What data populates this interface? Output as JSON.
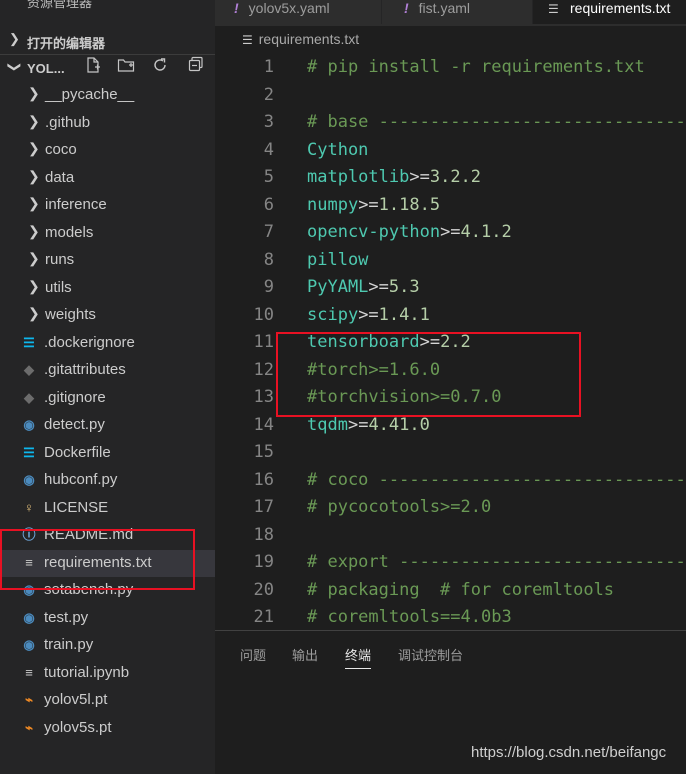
{
  "sidebar": {
    "title": "资源管理器",
    "more": "···",
    "open_editors_label": "打开的编辑器",
    "project_label": "YOL...",
    "actions": [
      "new-file-icon",
      "new-folder-icon",
      "refresh-icon",
      "collapse-all-icon"
    ],
    "items": [
      {
        "label": "__pycache__",
        "type": "folder"
      },
      {
        "label": ".github",
        "type": "folder"
      },
      {
        "label": "coco",
        "type": "folder"
      },
      {
        "label": "data",
        "type": "folder"
      },
      {
        "label": "inference",
        "type": "folder"
      },
      {
        "label": "models",
        "type": "folder"
      },
      {
        "label": "runs",
        "type": "folder"
      },
      {
        "label": "utils",
        "type": "folder"
      },
      {
        "label": "weights",
        "type": "folder"
      },
      {
        "label": ".dockerignore",
        "type": "docker"
      },
      {
        "label": ".gitattributes",
        "type": "git"
      },
      {
        "label": ".gitignore",
        "type": "git"
      },
      {
        "label": "detect.py",
        "type": "python"
      },
      {
        "label": "Dockerfile",
        "type": "docker"
      },
      {
        "label": "hubconf.py",
        "type": "python"
      },
      {
        "label": "LICENSE",
        "type": "license"
      },
      {
        "label": "README.md",
        "type": "info"
      },
      {
        "label": "requirements.txt",
        "type": "text"
      },
      {
        "label": "sotabench.py",
        "type": "python"
      },
      {
        "label": "test.py",
        "type": "python"
      },
      {
        "label": "train.py",
        "type": "python"
      },
      {
        "label": "tutorial.ipynb",
        "type": "text"
      },
      {
        "label": "yolov5l.pt",
        "type": "rss"
      },
      {
        "label": "yolov5s.pt",
        "type": "rss"
      }
    ]
  },
  "tabs": [
    {
      "label": "yolov5x.yaml",
      "active": false
    },
    {
      "label": "fist.yaml",
      "active": false
    },
    {
      "label": "requirements.txt",
      "active": true
    }
  ],
  "breadcrumb": "requirements.txt",
  "code_lines": [
    {
      "n": "1",
      "text": "# pip install -r requirements.txt"
    },
    {
      "n": "2",
      "text": ""
    },
    {
      "n": "3",
      "text": "# base ----------------------------------------"
    },
    {
      "n": "4",
      "text": "Cython"
    },
    {
      "n": "5",
      "text": "matplotlib>=3.2.2"
    },
    {
      "n": "6",
      "text": "numpy>=1.18.5"
    },
    {
      "n": "7",
      "text": "opencv-python>=4.1.2"
    },
    {
      "n": "8",
      "text": "pillow"
    },
    {
      "n": "9",
      "text": "PyYAML>=5.3"
    },
    {
      "n": "10",
      "text": "scipy>=1.4.1"
    },
    {
      "n": "11",
      "text": "tensorboard>=2.2"
    },
    {
      "n": "12",
      "text": "#torch>=1.6.0"
    },
    {
      "n": "13",
      "text": "#torchvision>=0.7.0"
    },
    {
      "n": "14",
      "text": "tqdm>=4.41.0"
    },
    {
      "n": "15",
      "text": ""
    },
    {
      "n": "16",
      "text": "# coco ----------------------------------------"
    },
    {
      "n": "17",
      "text": "# pycocotools>=2.0"
    },
    {
      "n": "18",
      "text": ""
    },
    {
      "n": "19",
      "text": "# export --------------------------------------"
    },
    {
      "n": "20",
      "text": "# packaging  # for coremltools"
    },
    {
      "n": "21",
      "text": "# coremltools==4.0b3"
    }
  ],
  "panel_tabs": [
    {
      "label": "问题",
      "active": false
    },
    {
      "label": "输出",
      "active": false
    },
    {
      "label": "终端",
      "active": true
    },
    {
      "label": "调试控制台",
      "active": false
    }
  ],
  "watermark": "https://blog.csdn.net/beifangc",
  "colors": {
    "annotation_red": "#e81123",
    "comment": "#6a9955",
    "package": "#4ec9b0",
    "version": "#b5cea8"
  }
}
